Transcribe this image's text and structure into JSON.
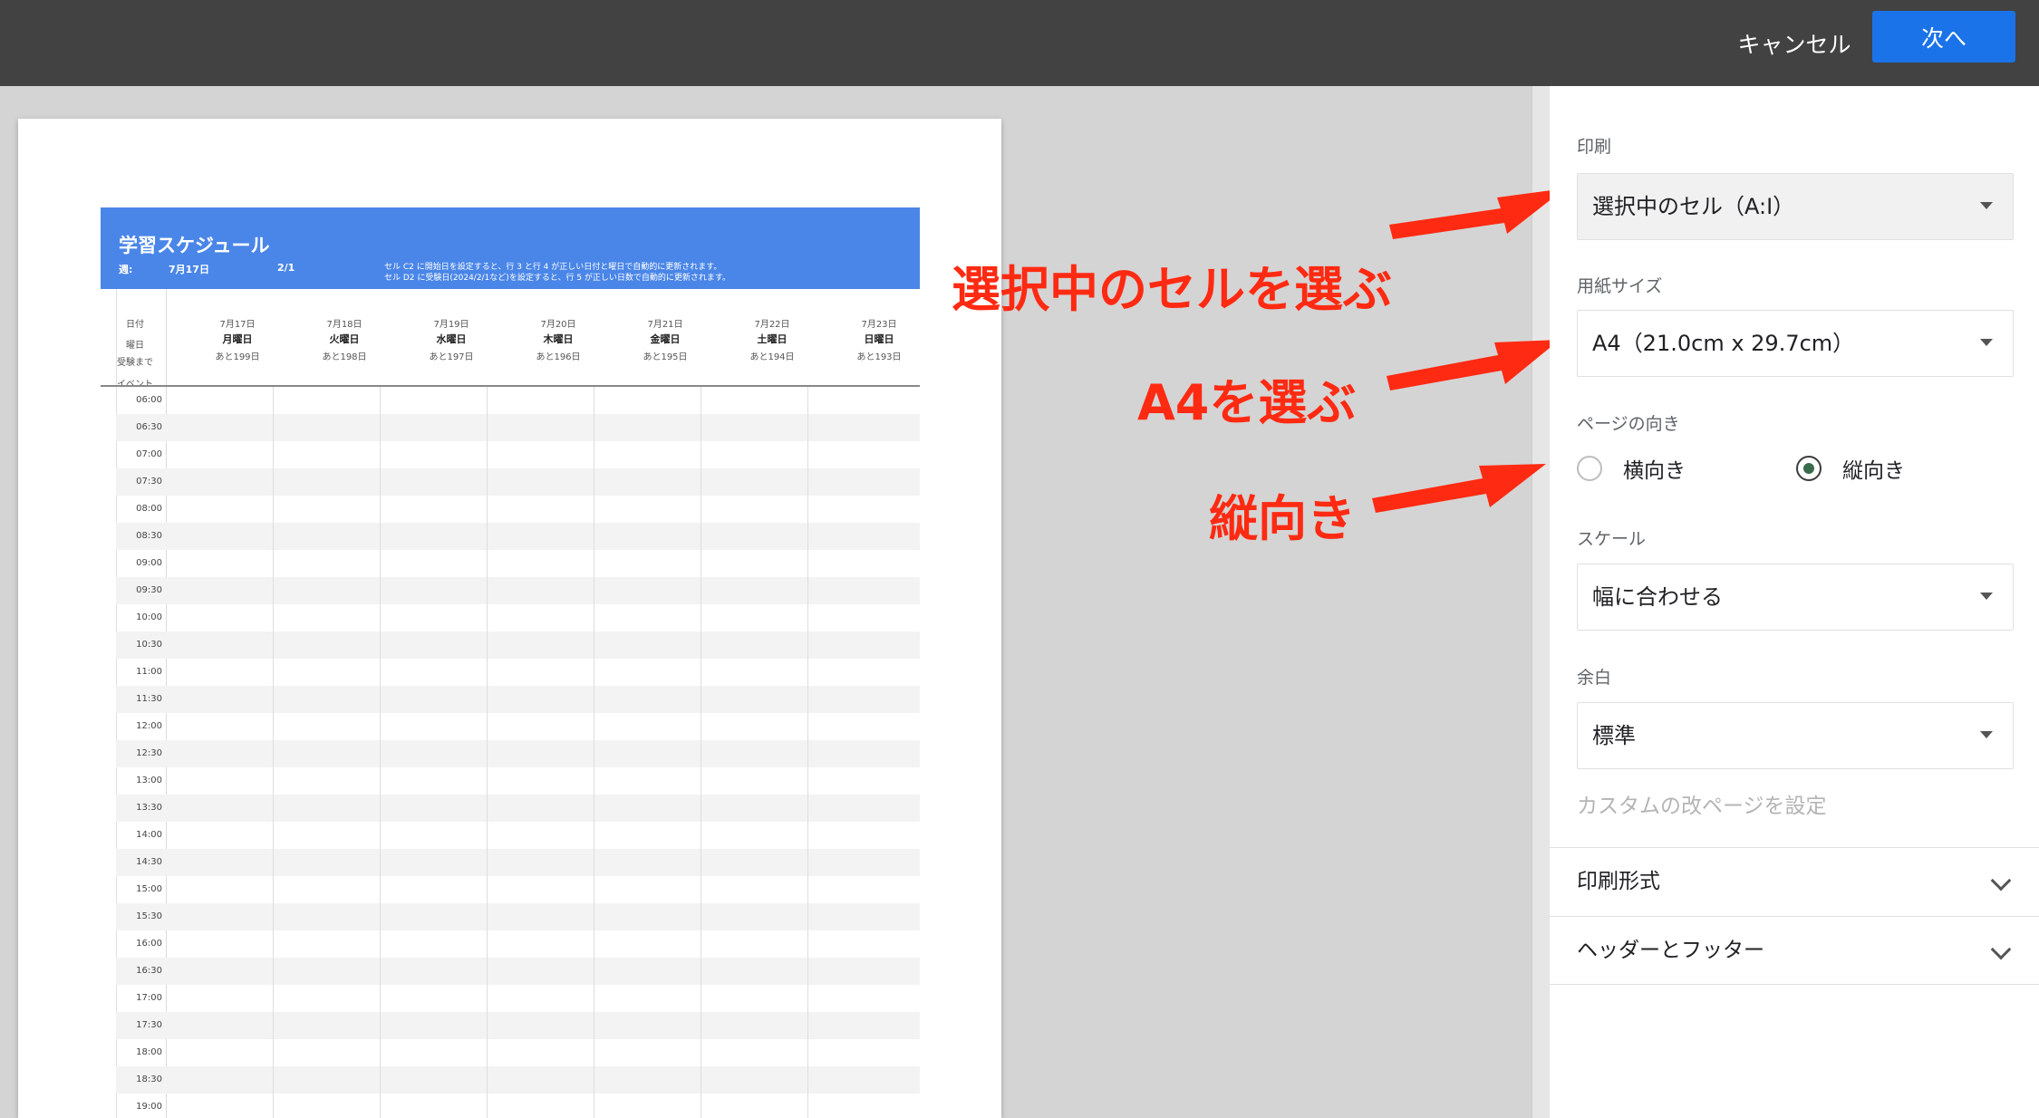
{
  "topbar": {
    "cancel_label": "キャンセル",
    "next_label": "次へ",
    "accent_color": "#1a73e8"
  },
  "sheet": {
    "title": "学習スケジュール",
    "week_label": "週:",
    "week_date": "7月17日",
    "exam_date": "2/1",
    "note_1": "セル C2 に開始日を設定すると、行 3 と行 4 が正しい日付と曜日で自動的に更新されます。",
    "note_2": "セル D2 に受験日(2024/2/1など)を設定すると、行 5 が正しい日数で自動的に更新されます。",
    "header_color": "#4a86e8",
    "row_labels": [
      "日付",
      "曜日",
      "受験まで",
      "イベント"
    ],
    "days": [
      {
        "date": "7月17日",
        "name": "月曜日",
        "left": "あと199日"
      },
      {
        "date": "7月18日",
        "name": "火曜日",
        "left": "あと198日"
      },
      {
        "date": "7月19日",
        "name": "水曜日",
        "left": "あと197日"
      },
      {
        "date": "7月20日",
        "name": "木曜日",
        "left": "あと196日"
      },
      {
        "date": "7月21日",
        "name": "金曜日",
        "left": "あと195日"
      },
      {
        "date": "7月22日",
        "name": "土曜日",
        "left": "あと194日"
      },
      {
        "date": "7月23日",
        "name": "日曜日",
        "left": "あと193日"
      }
    ],
    "times": [
      "06:00",
      "06:30",
      "07:00",
      "07:30",
      "08:00",
      "08:30",
      "09:00",
      "09:30",
      "10:00",
      "10:30",
      "11:00",
      "11:30",
      "12:00",
      "12:30",
      "13:00",
      "13:30",
      "14:00",
      "14:30",
      "15:00",
      "15:30",
      "16:00",
      "16:30",
      "17:00",
      "17:30",
      "18:00",
      "18:30",
      "19:00"
    ]
  },
  "annotations": {
    "select_cells": "選択中のセルを選ぶ",
    "select_a4": "A4を選ぶ",
    "portrait": "縦向き",
    "color": "#ff2a12"
  },
  "panel": {
    "print_label": "印刷",
    "print_value": "選択中のセル（A:I）",
    "paper_label": "用紙サイズ",
    "paper_value": "A4（21.0cm x 29.7cm）",
    "orientation_label": "ページの向き",
    "landscape_label": "横向き",
    "portrait_label": "縦向き",
    "scale_label": "スケール",
    "scale_value": "幅に合わせる",
    "margin_label": "余白",
    "margin_value": "標準",
    "custom_break_label": "カスタムの改ページを設定",
    "format_label": "印刷形式",
    "header_footer_label": "ヘッダーとフッター"
  }
}
